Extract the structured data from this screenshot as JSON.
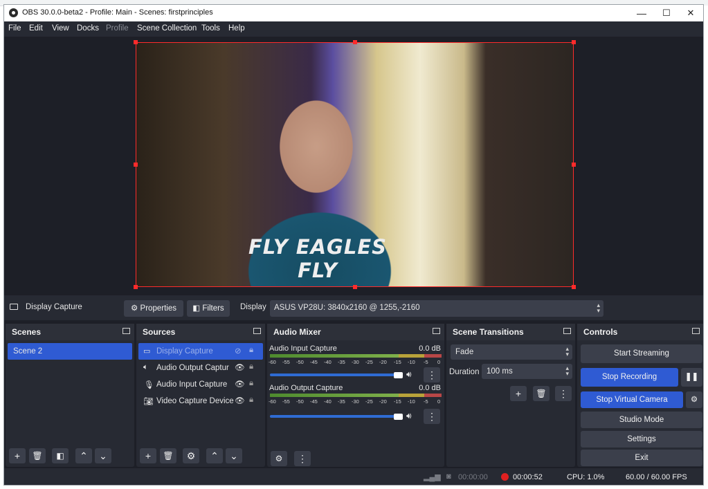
{
  "window": {
    "title": "OBS 30.0.0-beta2 - Profile: Main - Scenes: firstprinciples",
    "minimize_glyph": "—",
    "maximize_glyph": "☐",
    "close_glyph": "✕"
  },
  "menu": [
    "File",
    "Edit",
    "View",
    "Docks",
    "Profile",
    "Scene Collection",
    "Tools",
    "Help"
  ],
  "preview": {
    "shirt_text": "FLY EAGLES FLY"
  },
  "source_toolbar": {
    "source_name": "Display Capture",
    "properties_label": "Properties",
    "filters_label": "Filters",
    "display_label": "Display",
    "display_value": "ASUS VP28U: 3840x2160 @ 1255,-2160"
  },
  "scenes": {
    "title": "Scenes",
    "items": [
      "Scene 2"
    ]
  },
  "sources": {
    "title": "Sources",
    "items": [
      "Display Capture",
      "Audio Output Captur",
      "Audio Input Capture",
      "Video Capture Device"
    ]
  },
  "audio_mixer": {
    "title": "Audio Mixer",
    "channels": [
      {
        "name": "Audio Input Capture",
        "level": "0.0 dB"
      },
      {
        "name": "Audio Output Capture",
        "level": "0.0 dB"
      }
    ],
    "ticks": [
      "-60",
      "-55",
      "-50",
      "-45",
      "-40",
      "-35",
      "-30",
      "-25",
      "-20",
      "-15",
      "-10",
      "-5",
      "0"
    ]
  },
  "transitions": {
    "title": "Scene Transitions",
    "selected": "Fade",
    "duration_label": "Duration",
    "duration_value": "100 ms"
  },
  "controls": {
    "title": "Controls",
    "start_streaming": "Start Streaming",
    "stop_recording": "Stop Recording",
    "stop_virtual_camera": "Stop Virtual Camera",
    "studio_mode": "Studio Mode",
    "settings": "Settings",
    "exit": "Exit"
  },
  "status": {
    "stream_time": "00:00:00",
    "record_time": "00:00:52",
    "cpu": "CPU: 1.0%",
    "fps": "60.00 / 60.00 FPS"
  },
  "colors": {
    "accent_blue": "#2f5bd3",
    "selection_red": "#ff2b2b",
    "record_red": "#e02020"
  }
}
